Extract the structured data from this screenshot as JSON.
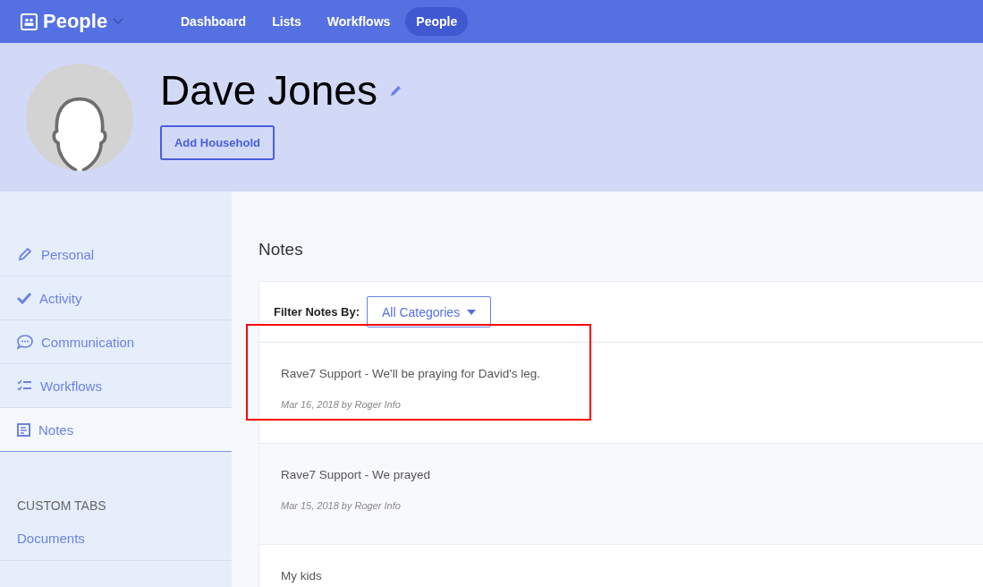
{
  "app": {
    "title": "People"
  },
  "nav": [
    {
      "label": "Dashboard",
      "selected": false
    },
    {
      "label": "Lists",
      "selected": false
    },
    {
      "label": "Workflows",
      "selected": false
    },
    {
      "label": "People",
      "selected": true
    }
  ],
  "profile": {
    "name": "Dave Jones",
    "add_button": "Add Household"
  },
  "sidebar": {
    "items": [
      {
        "label": "Personal",
        "kind": "pencil",
        "selected": false
      },
      {
        "label": "Activity",
        "kind": "check",
        "selected": false
      },
      {
        "label": "Communication",
        "kind": "chat",
        "selected": false
      },
      {
        "label": "Workflows",
        "kind": "checklist",
        "selected": false
      },
      {
        "label": "Notes",
        "kind": "note",
        "selected": true
      }
    ],
    "custom_tabs_heading": "CUSTOM TABS",
    "custom_tabs": [
      {
        "label": "Documents"
      }
    ]
  },
  "notes": {
    "title": "Notes",
    "filter_label": "Filter Notes By:",
    "filter_value": "All Categories",
    "items": [
      {
        "text": "Rave7 Support - We'll be praying for David's leg.",
        "meta": "Mar 16, 2018 by Roger Info",
        "highlighted": true
      },
      {
        "text": "Rave7 Support - We prayed",
        "meta": "Mar 15, 2018 by Roger Info",
        "highlighted": false
      },
      {
        "text": "My kids",
        "highlighted": false
      }
    ]
  }
}
